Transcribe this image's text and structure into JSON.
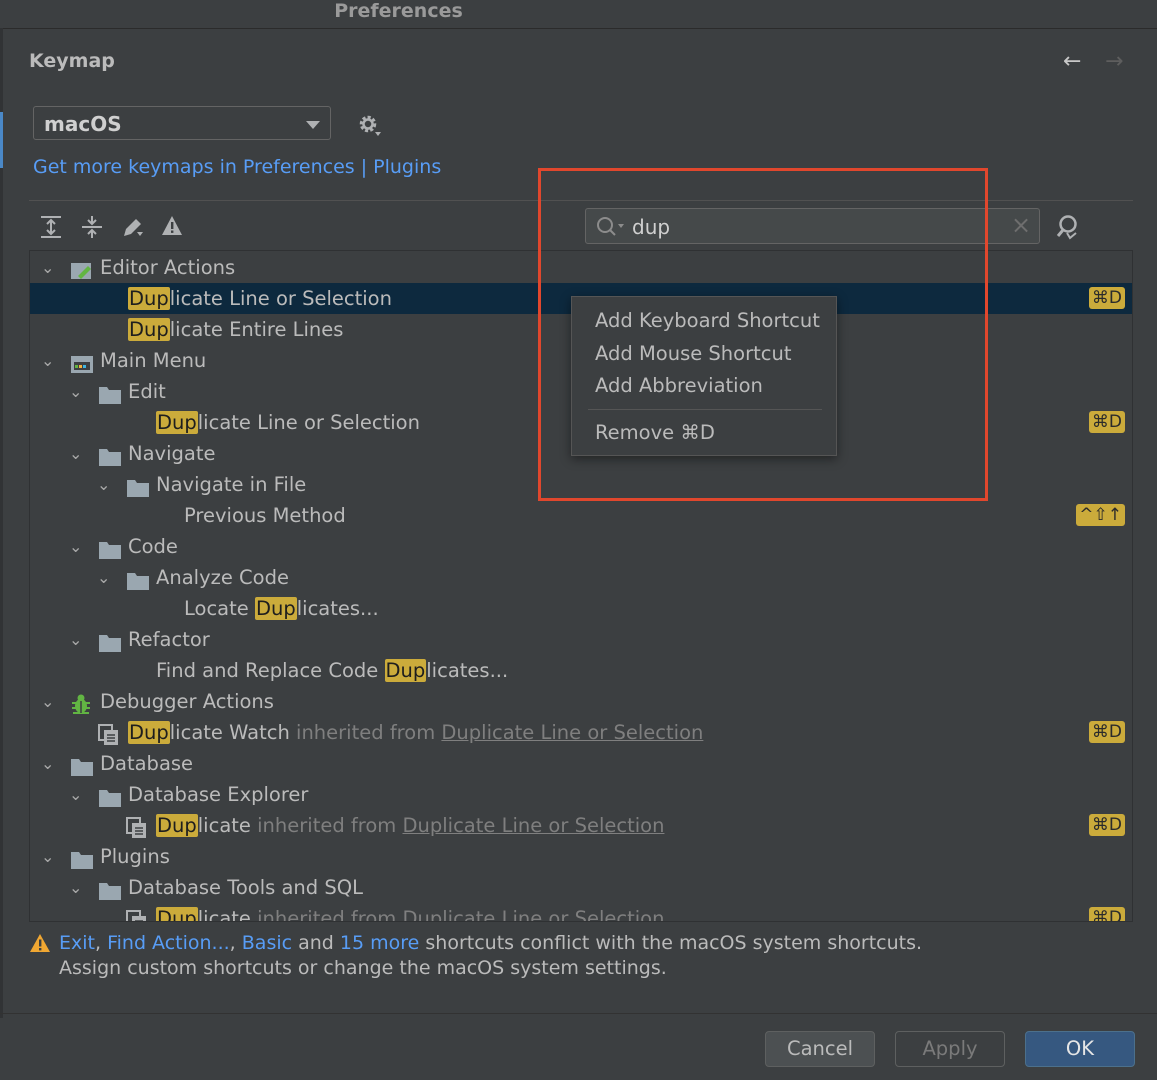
{
  "window": {
    "title": "Preferences"
  },
  "header": {
    "title": "Keymap",
    "back_arrow": "←",
    "forward_arrow": "→"
  },
  "keymap": {
    "selected": "macOS",
    "link": "Get more keymaps in Preferences | Plugins"
  },
  "search": {
    "value": "dup",
    "clear": "×"
  },
  "tree": {
    "editor_actions": "Editor Actions",
    "r1_hl": "Dup",
    "r1_rest": "licate Line or Selection",
    "r1_kbd": "⌘D",
    "r2_hl": "Dup",
    "r2_rest": "licate Entire Lines",
    "main_menu": "Main Menu",
    "edit": "Edit",
    "r3_hl": "Dup",
    "r3_rest": "licate Line or Selection",
    "r3_kbd": "⌘D",
    "navigate": "Navigate",
    "navigate_in_file": "Navigate in File",
    "previous_method": "Previous Method",
    "previous_method_kbd": "^⇧↑",
    "code": "Code",
    "analyze_code": "Analyze Code",
    "locate_pre": "Locate ",
    "locate_hl": "Dup",
    "locate_rest": "licates...",
    "refactor": "Refactor",
    "find_pre": "Find and Replace Code ",
    "find_hl": "Dup",
    "find_rest": "licates...",
    "debugger_actions": "Debugger Actions",
    "watch_hl": "Dup",
    "watch_rest": "licate Watch",
    "inherited_from": "inherited from",
    "inherited_target": "Duplicate Line or Selection",
    "watch_kbd": "⌘D",
    "database": "Database",
    "database_explorer": "Database Explorer",
    "db_hl": "Dup",
    "db_rest": "licate",
    "db_kbd": "⌘D",
    "plugins": "Plugins",
    "db_tools": "Database Tools and SQL",
    "plug_hl": "Dup",
    "plug_rest": "licate",
    "plug_kbd": "⌘D"
  },
  "context_menu": {
    "add_keyboard": "Add Keyboard Shortcut",
    "add_mouse": "Add Mouse Shortcut",
    "add_abbreviation": "Add Abbreviation",
    "remove": "Remove ⌘D"
  },
  "warning": {
    "exit": "Exit",
    "comma1": ", ",
    "find_action": "Find Action...",
    "comma2": ", ",
    "basic": "Basic",
    "and": " and ",
    "more": "15 more",
    "line1_rest": " shortcuts conflict with the macOS system shortcuts.",
    "line2": "Assign custom shortcuts or change the macOS system settings."
  },
  "buttons": {
    "cancel": "Cancel",
    "apply": "Apply",
    "ok": "OK"
  },
  "colors": {
    "accent": "#365880",
    "highlight": "#cbab3b",
    "link": "#589df6",
    "annotation_box": "#e1472d"
  }
}
